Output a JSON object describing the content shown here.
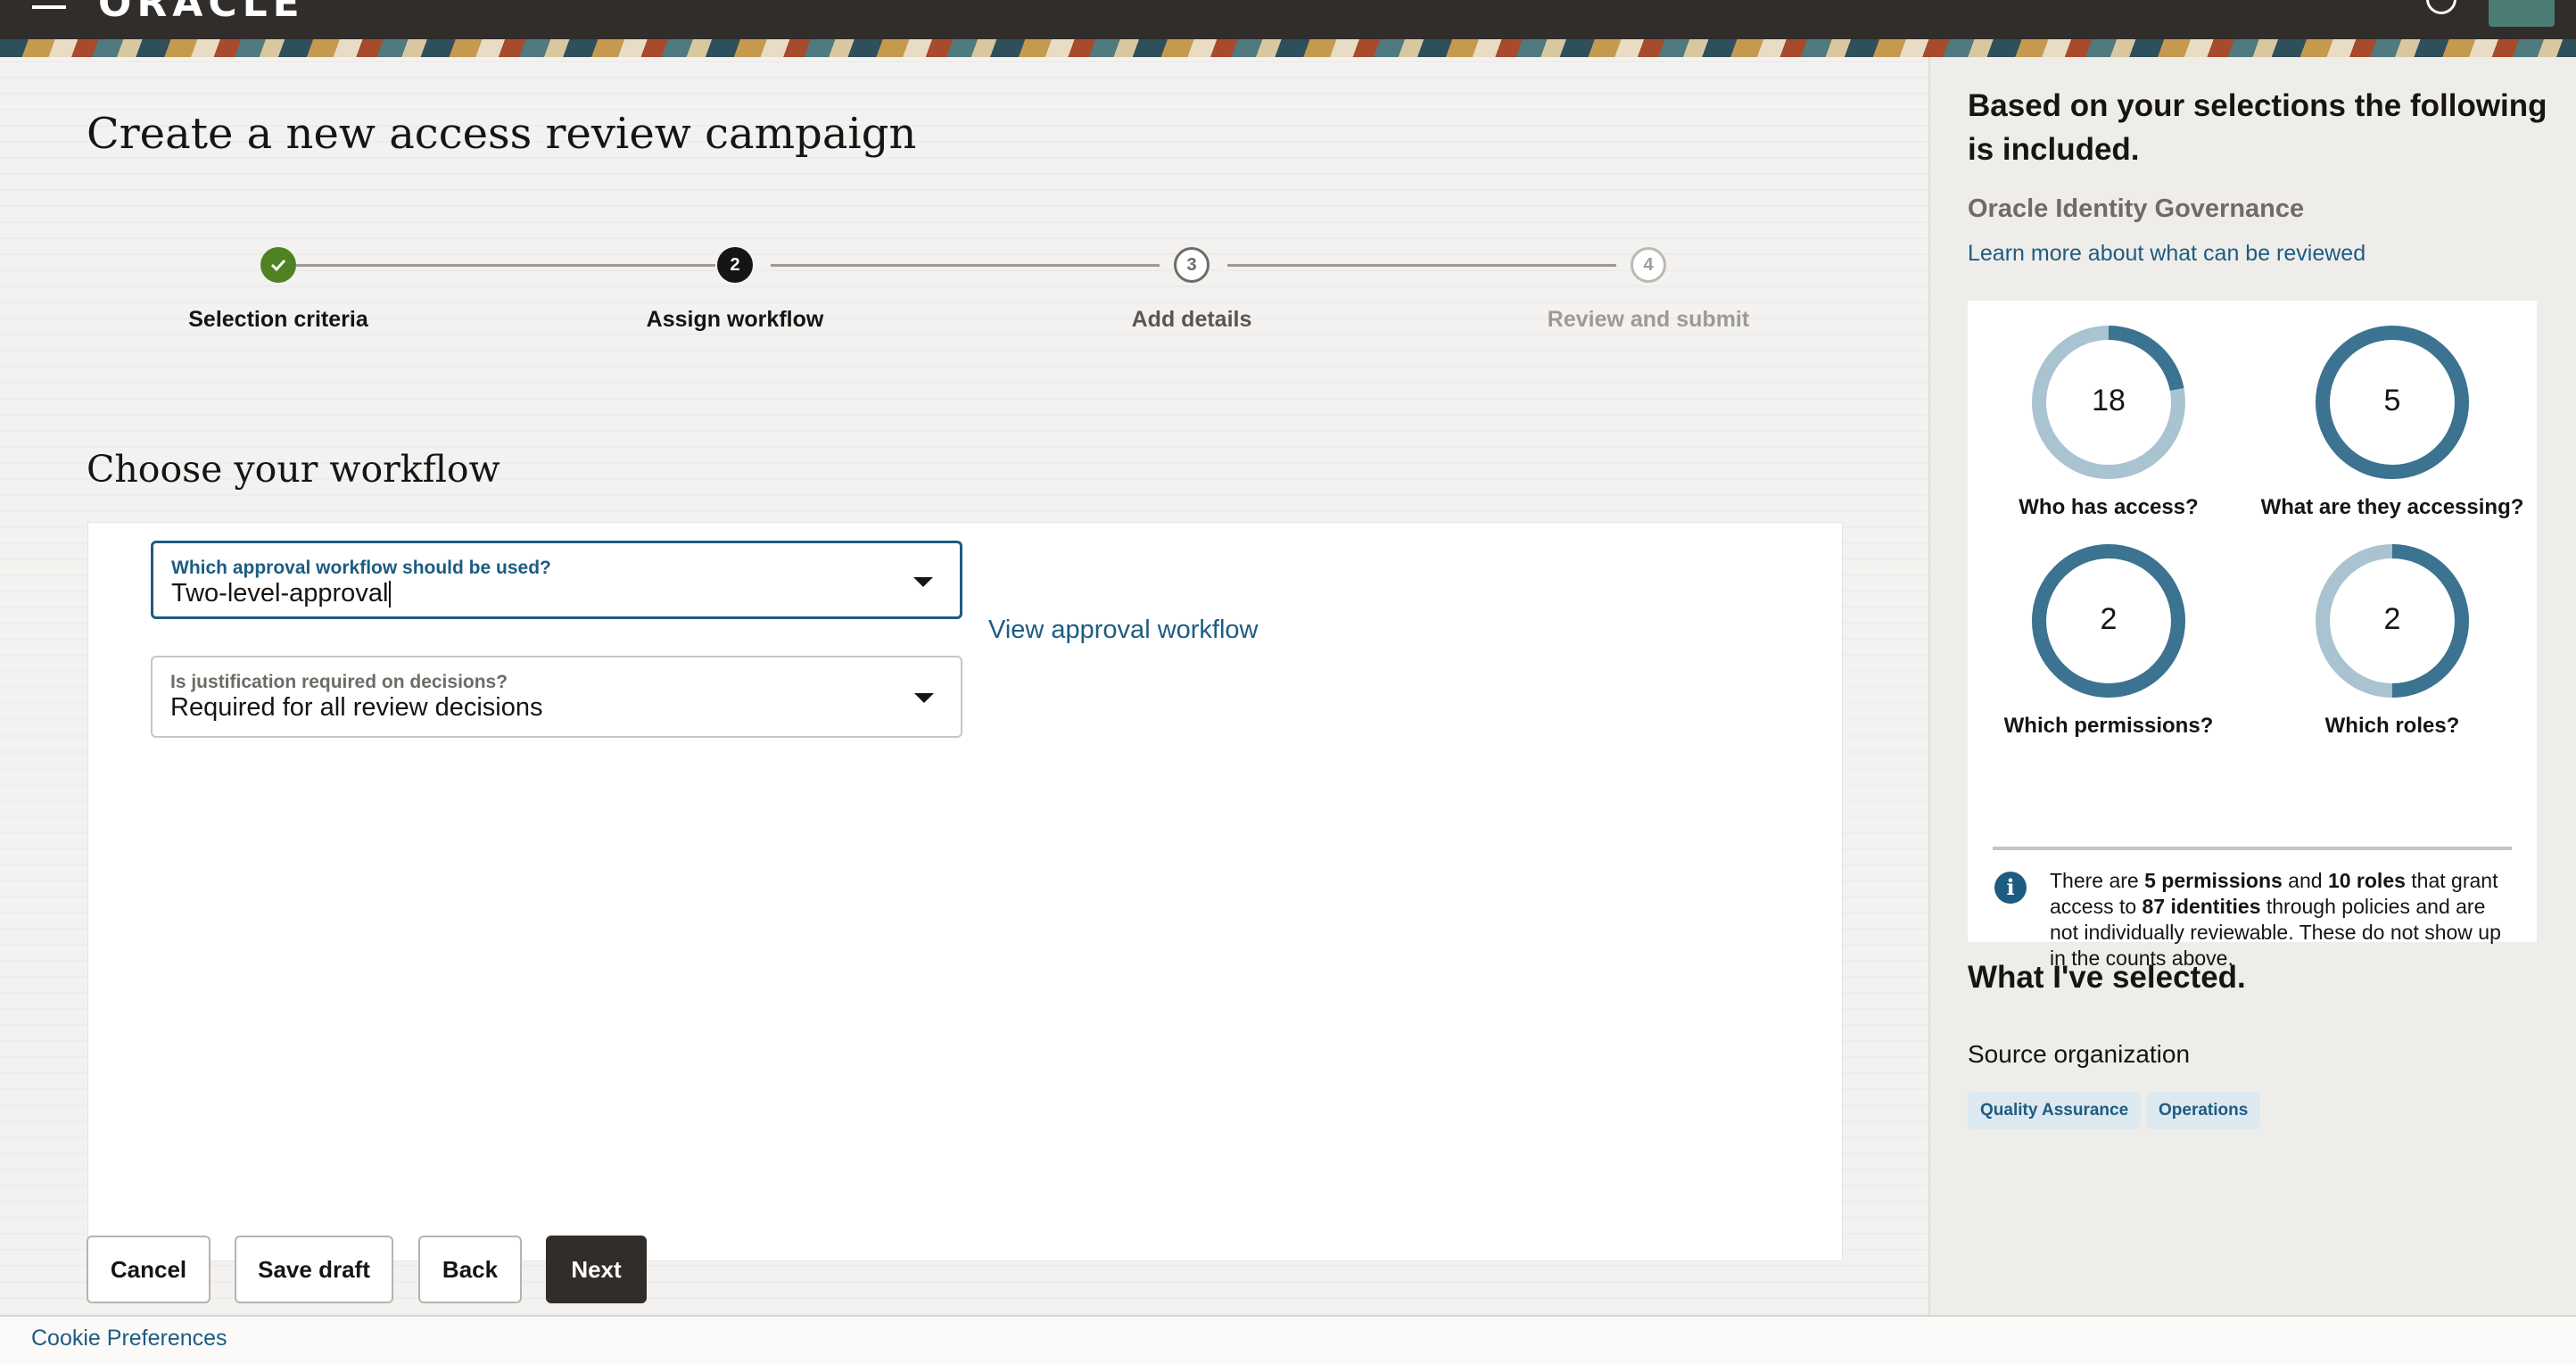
{
  "header": {
    "logo_text": "ORACLE"
  },
  "page": {
    "title": "Create a new access review campaign"
  },
  "steps": [
    {
      "number": "✓",
      "label": "Selection criteria",
      "state": "completed"
    },
    {
      "number": "2",
      "label": "Assign workflow",
      "state": "current"
    },
    {
      "number": "3",
      "label": "Add details",
      "state": "upcoming"
    },
    {
      "number": "4",
      "label": "Review and submit",
      "state": "disabled"
    }
  ],
  "workflow": {
    "section_title": "Choose your workflow",
    "approval_label": "Which approval workflow should be used?",
    "approval_value": "Two-level-approval",
    "view_link": "View approval workflow",
    "justification_label": "Is justification required on decisions?",
    "justification_value": "Required for all review decisions"
  },
  "buttons": {
    "cancel": "Cancel",
    "save_draft": "Save draft",
    "back": "Back",
    "next": "Next"
  },
  "footer": {
    "cookie": "Cookie Preferences"
  },
  "summary": {
    "title": "Based on your selections the following is included.",
    "product": "Oracle Identity Governance",
    "learn_link": "Learn more about what can be reviewed",
    "metrics": [
      {
        "value": "18",
        "label": "Who has access?",
        "fill": 0.22
      },
      {
        "value": "5",
        "label": "What are they accessing?",
        "fill": 1.0
      },
      {
        "value": "2",
        "label": "Which permissions?",
        "fill": 1.0
      },
      {
        "value": "2",
        "label": "Which roles?",
        "fill": 0.5
      }
    ],
    "info": {
      "t1": "There are ",
      "permissions": "5 permissions",
      "t2": " and ",
      "roles": "10 roles",
      "t3": " that grant access to ",
      "identities": "87 identities",
      "t4": " through policies and are not individually reviewable. These do not show up in the counts above."
    },
    "selected_title": "What I've selected.",
    "source_org_label": "Source organization",
    "chips": [
      "Quality Assurance",
      "Operations"
    ]
  },
  "colors": {
    "accent": "#1d5c82",
    "ring_dark": "#3b7391",
    "ring_light": "#a9c3d1",
    "success": "#508223",
    "header_bg": "#312d2a"
  }
}
